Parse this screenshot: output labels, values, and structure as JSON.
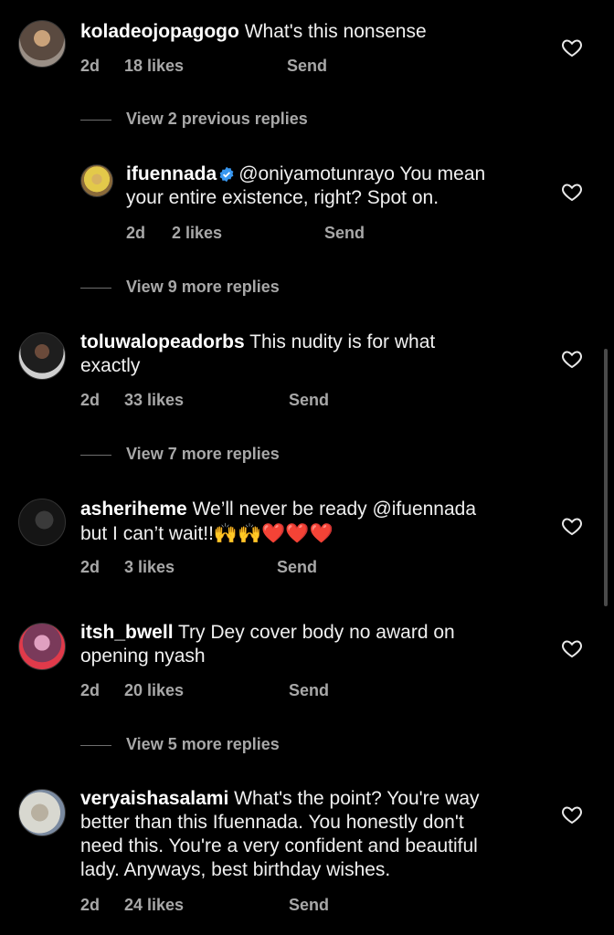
{
  "comments": [
    {
      "username": "koladeojopagogo",
      "text": "What's this nonsense",
      "time": "2d",
      "likes": "18 likes",
      "send": "Send"
    },
    {
      "username": "ifuennada",
      "line1": "@oniyamotunrayo You mean",
      "line2": "your entire existence, right? Spot on.",
      "time": "2d",
      "likes": "2 likes",
      "send": "Send"
    },
    {
      "username": "toluwalopeadorbs",
      "line1": "This nudity is for what",
      "line2": "exactly",
      "time": "2d",
      "likes": "33 likes",
      "send": "Send"
    },
    {
      "username": "asheriheme",
      "line1": "We’ll never be ready @ifuennada",
      "line2": "but I can’t wait!!",
      "emojis": "🙌🙌❤️❤️❤️",
      "time": "2d",
      "likes": "3 likes",
      "send": "Send"
    },
    {
      "username": "itsh_bwell",
      "line1": "Try Dey cover body no award on",
      "line2": "opening nyash",
      "time": "2d",
      "likes": "20 likes",
      "send": "Send"
    },
    {
      "username": "veryaishasalami",
      "line1": "What's the point? You're way",
      "line2": "better than this Ifuennada. You honestly don't",
      "line3": "need this. You're a very confident and beautiful",
      "line4": "lady. Anyways, best birthday wishes.",
      "time": "2d",
      "likes": "24 likes",
      "send": "Send"
    }
  ],
  "replies": [
    {
      "label": "View 2 previous replies"
    },
    {
      "label": "View 9 more replies"
    },
    {
      "label": "View 7 more replies"
    },
    {
      "label": "View 5 more replies"
    }
  ],
  "icons": {
    "like": "heart-icon",
    "verified": "verified-badge-icon",
    "verified_color": "#3897f0"
  }
}
